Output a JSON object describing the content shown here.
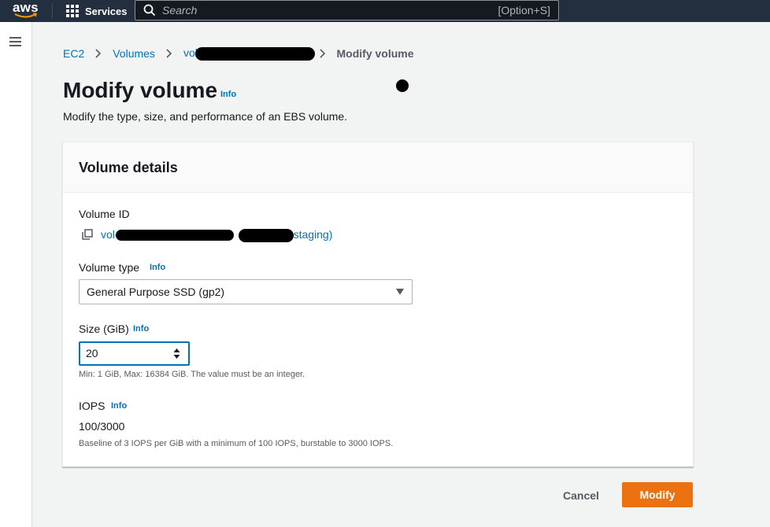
{
  "topnav": {
    "logo_text": "aws",
    "services_label": "Services",
    "search_placeholder": "Search",
    "search_shortcut": "[Option+S]"
  },
  "breadcrumb": {
    "items": [
      "EC2",
      "Volumes",
      "vol-"
    ],
    "current": "Modify volume"
  },
  "page": {
    "title": "Modify volume",
    "info": "Info",
    "description": "Modify the type, size, and performance of an EBS volume."
  },
  "volume_details": {
    "heading": "Volume details",
    "volume_id_label": "Volume ID",
    "volume_id_prefix": "vol-",
    "volume_id_suffix": "staging)",
    "volume_type_label": "Volume type",
    "volume_type_info": "Info",
    "volume_type_value": "General Purpose SSD (gp2)",
    "size_label": "Size (GiB)",
    "size_info": "Info",
    "size_value": "20",
    "size_hint": "Min: 1 GiB, Max: 16384 GiB. The value must be an integer.",
    "iops_label": "IOPS",
    "iops_info": "Info",
    "iops_value": "100/3000",
    "iops_hint": "Baseline of 3 IOPS per GiB with a minimum of 100 IOPS, burstable to 3000 IOPS."
  },
  "actions": {
    "cancel_label": "Cancel",
    "modify_label": "Modify"
  },
  "colors": {
    "nav_bg": "#232f3e",
    "link": "#0073bb",
    "primary_button": "#ec7211"
  }
}
